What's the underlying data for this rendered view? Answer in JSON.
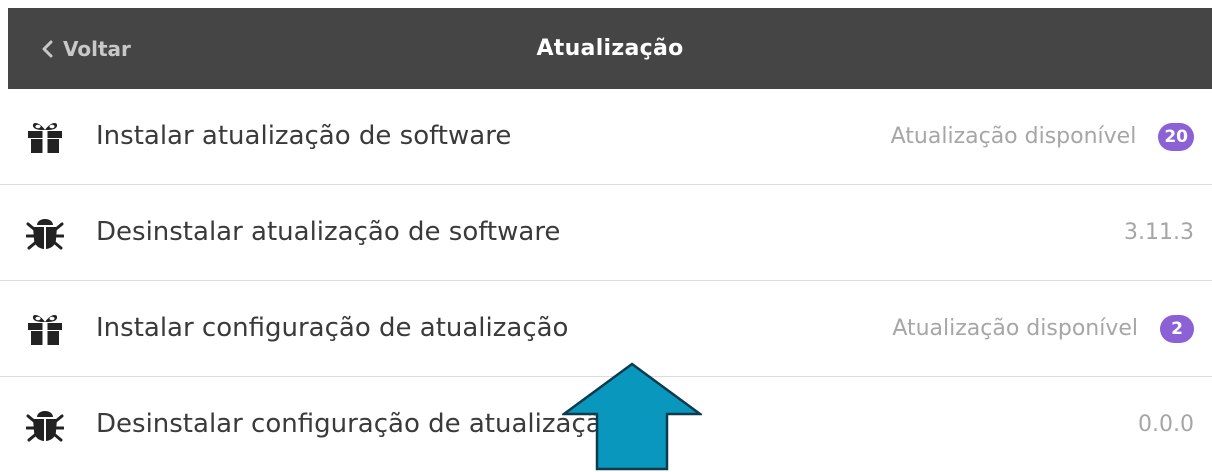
{
  "header": {
    "back_label": "Voltar",
    "title": "Atualização"
  },
  "rows": [
    {
      "icon": "gift-icon",
      "label": "Instalar atualização de software",
      "status": "Atualização disponível",
      "badge": "20"
    },
    {
      "icon": "bug-icon",
      "label": "Desinstalar atualização de software",
      "version": "3.11.3"
    },
    {
      "icon": "gift-icon",
      "label": "Instalar configuração de atualização",
      "status": "Atualização disponível",
      "badge": "2"
    },
    {
      "icon": "bug-icon",
      "label": "Desinstalar configuração de atualização",
      "version": "0.0.0"
    }
  ],
  "colors": {
    "header_bg": "#454545",
    "badge": "#8c61d6",
    "annotation_arrow": "#0a97bd"
  }
}
